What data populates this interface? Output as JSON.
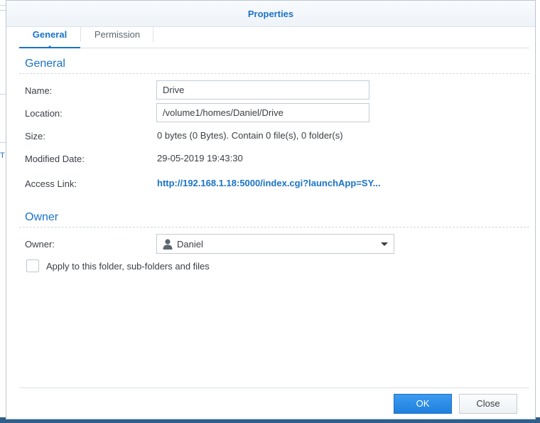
{
  "dialog": {
    "title": "Properties"
  },
  "tabs": [
    {
      "label": "General",
      "active": true
    },
    {
      "label": "Permission",
      "active": false
    }
  ],
  "general": {
    "section_title": "General",
    "name_label": "Name:",
    "name_value": "Drive",
    "location_label": "Location:",
    "location_value": "/volume1/homes/Daniel/Drive",
    "size_label": "Size:",
    "size_value": "0 bytes (0 Bytes). Contain 0 file(s), 0 folder(s)",
    "modified_label": "Modified Date:",
    "modified_value": "29-05-2019 19:43:30",
    "access_label": "Access Link:",
    "access_value": "http://192.168.1.18:5000/index.cgi?launchApp=SY..."
  },
  "owner": {
    "section_title": "Owner",
    "owner_label": "Owner:",
    "owner_value": "Daniel",
    "owner_icon": "user-icon",
    "apply_label": "Apply to this folder, sub-folders and files",
    "apply_checked": false
  },
  "buttons": {
    "ok": "OK",
    "close": "Close"
  },
  "background": {
    "partial_text": "T"
  },
  "colors": {
    "accent": "#1a73c9",
    "ok_button": "#2a8be6"
  }
}
